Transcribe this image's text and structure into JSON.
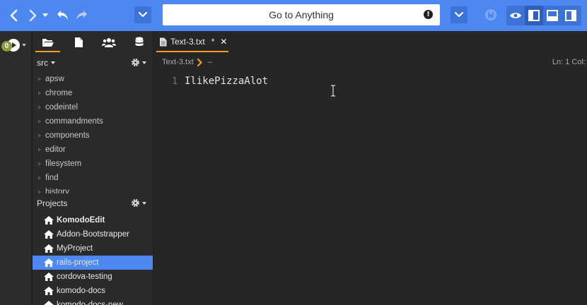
{
  "toolbar": {
    "goto_label": "Go to Anything",
    "accent_color": "#4d88f0"
  },
  "leftbar": {
    "notification_count": "0"
  },
  "sidepanel": {
    "tabs": [
      {
        "name": "folder-open-icon"
      },
      {
        "name": "file-icon"
      },
      {
        "name": "users-icon"
      },
      {
        "name": "database-icon"
      }
    ],
    "places_root": "src",
    "tree": [
      {
        "label": "apsw"
      },
      {
        "label": "chrome"
      },
      {
        "label": "codeintel"
      },
      {
        "label": "commandments"
      },
      {
        "label": "components"
      },
      {
        "label": "editor"
      },
      {
        "label": "filesystem"
      },
      {
        "label": "find"
      },
      {
        "label": "history"
      }
    ],
    "projects_label": "Projects",
    "projects": [
      {
        "label": "KomodoEdit",
        "bold": true
      },
      {
        "label": "Addon-Bootstrapper"
      },
      {
        "label": "MyProject"
      },
      {
        "label": "rails-project",
        "selected": true
      },
      {
        "label": "cordova-testing"
      },
      {
        "label": "komodo-docs"
      },
      {
        "label": "komodo-docs-new"
      }
    ]
  },
  "editor": {
    "tab_label": "Text-3.txt",
    "tab_modified": "*",
    "tab_close": "✕",
    "breadcrumb_file": "Text-3.txt",
    "breadcrumb_symbol": "–",
    "status": "Ln: 1 Col:",
    "line_number": "1",
    "line_text": "IlikePizzaAlot"
  }
}
